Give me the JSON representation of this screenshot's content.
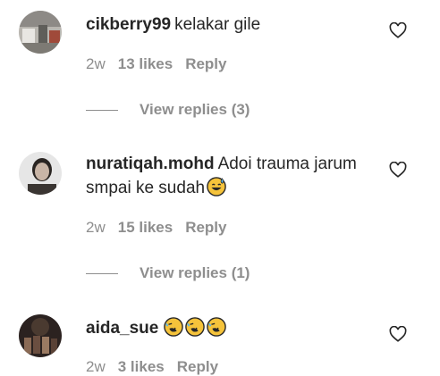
{
  "comments": [
    {
      "username": "cikberry99",
      "text": "kelakar gile",
      "emojis": [],
      "time": "2w",
      "likes": "13 likes",
      "reply_label": "Reply",
      "view_replies": "View replies (3)",
      "avatar_icon": "user-avatar-photo"
    },
    {
      "username": "nuratiqah.mohd",
      "text": "Adoi trauma jarum smpai ke sudah",
      "emojis": [
        "grinning-sweat-emoji"
      ],
      "time": "2w",
      "likes": "15 likes",
      "reply_label": "Reply",
      "view_replies": "View replies (1)",
      "avatar_icon": "user-avatar-photo"
    },
    {
      "username": "aida_sue",
      "text": "",
      "emojis": [
        "rolling-laughing-emoji",
        "rolling-laughing-emoji",
        "rolling-laughing-emoji"
      ],
      "time": "2w",
      "likes": "3 likes",
      "reply_label": "Reply",
      "avatar_icon": "user-avatar-photo"
    }
  ],
  "colors": {
    "text": "#262626",
    "muted": "#8e8e8e",
    "emoji": "#f5c33b"
  }
}
